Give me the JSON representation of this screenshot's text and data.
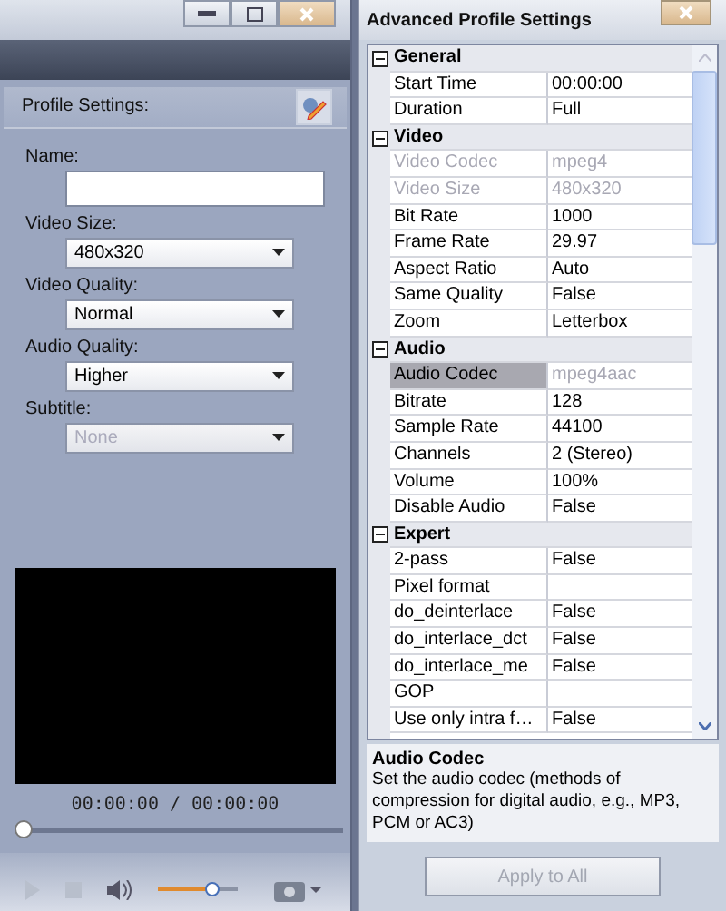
{
  "profile_panel": {
    "title": "Profile Settings:",
    "fields": [
      {
        "label": "Name:",
        "kind": "text"
      },
      {
        "label": "Video Size:",
        "kind": "dropdown",
        "value": "480x320",
        "disabled": false
      },
      {
        "label": "Video Quality:",
        "kind": "dropdown",
        "value": "Normal",
        "disabled": false
      },
      {
        "label": "Audio Quality:",
        "kind": "dropdown",
        "value": "Higher",
        "disabled": false
      },
      {
        "label": "Subtitle:",
        "kind": "dropdown",
        "value": "None",
        "disabled": true
      }
    ]
  },
  "player": {
    "time": "00:00:00 / 00:00:00",
    "seek": {
      "level": 0
    },
    "volume": {
      "level": 0.68
    }
  },
  "advanced": {
    "title": "Advanced Profile Settings",
    "categories": [
      {
        "name": "General",
        "expanded": true,
        "properties": [
          {
            "name": "Start Time",
            "value": "00:00:00",
            "disabled": false,
            "selected": false
          },
          {
            "name": "Duration",
            "value": "Full",
            "disabled": false,
            "selected": false
          }
        ]
      },
      {
        "name": "Video",
        "expanded": true,
        "properties": [
          {
            "name": "Video Codec",
            "value": "mpeg4",
            "disabled": true,
            "selected": false
          },
          {
            "name": "Video Size",
            "value": "480x320",
            "disabled": true,
            "selected": false
          },
          {
            "name": "Bit Rate",
            "value": "1000",
            "disabled": false,
            "selected": false
          },
          {
            "name": "Frame Rate",
            "value": "29.97",
            "disabled": false,
            "selected": false
          },
          {
            "name": "Aspect Ratio",
            "value": "Auto",
            "disabled": false,
            "selected": false
          },
          {
            "name": "Same Quality",
            "value": "False",
            "disabled": false,
            "selected": false
          },
          {
            "name": "Zoom",
            "value": "Letterbox",
            "disabled": false,
            "selected": false
          }
        ]
      },
      {
        "name": "Audio",
        "expanded": true,
        "properties": [
          {
            "name": "Audio Codec",
            "value": "mpeg4aac",
            "disabled": true,
            "selected": true
          },
          {
            "name": "Bitrate",
            "value": "128",
            "disabled": false,
            "selected": false
          },
          {
            "name": "Sample Rate",
            "value": "44100",
            "disabled": false,
            "selected": false
          },
          {
            "name": "Channels",
            "value": "2 (Stereo)",
            "disabled": false,
            "selected": false
          },
          {
            "name": "Volume",
            "value": "100%",
            "disabled": false,
            "selected": false
          },
          {
            "name": "Disable Audio",
            "value": "False",
            "disabled": false,
            "selected": false
          }
        ]
      },
      {
        "name": "Expert",
        "expanded": true,
        "properties": [
          {
            "name": "2-pass",
            "value": "False",
            "disabled": false,
            "selected": false
          },
          {
            "name": "Pixel format",
            "disabled": false,
            "selected": false
          },
          {
            "name": "do_deinterlace",
            "value": "False",
            "disabled": false,
            "selected": false
          },
          {
            "name": "do_interlace_dct",
            "value": "False",
            "disabled": false,
            "selected": false
          },
          {
            "name": "do_interlace_me",
            "value": "False",
            "disabled": false,
            "selected": false
          },
          {
            "name": "GOP",
            "disabled": false,
            "selected": false
          },
          {
            "name": "Use only intra f…",
            "value": "False",
            "disabled": false,
            "selected": false
          }
        ]
      }
    ],
    "description": {
      "title": "Audio Codec",
      "text": "Set the audio codec (methods of compression for digital audio, e.g., MP3, PCM or AC3)"
    },
    "apply_button": {
      "label": "Apply to All",
      "disabled": true
    }
  }
}
